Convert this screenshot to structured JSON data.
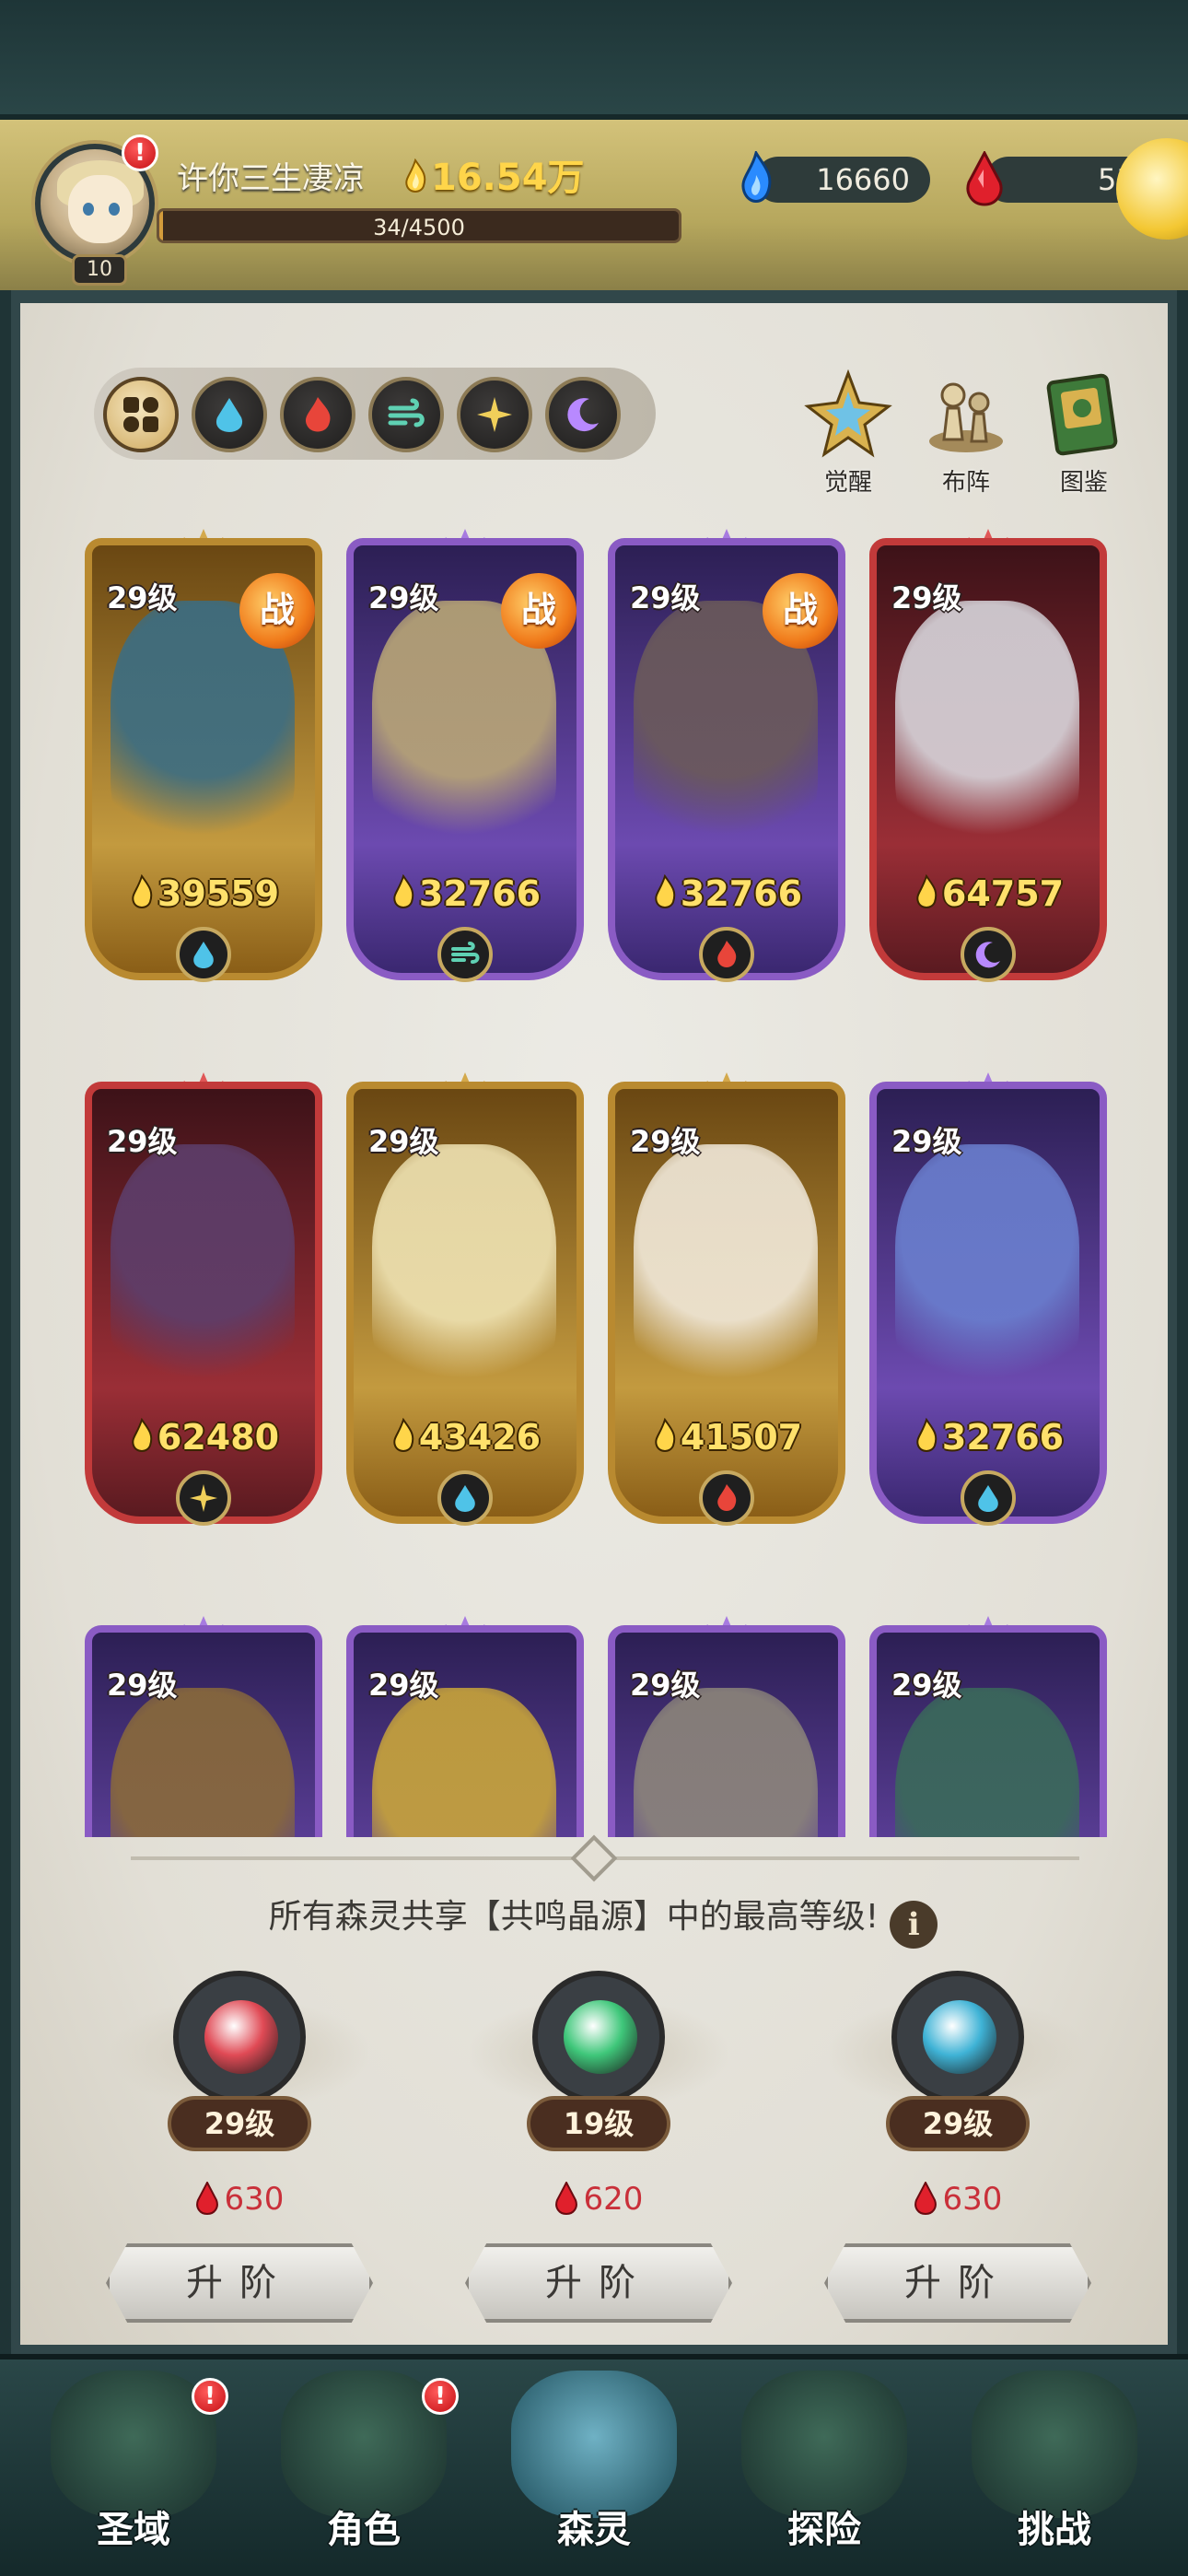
{
  "player": {
    "name": "许你三生凄凉",
    "level": "10",
    "gold": "16.54万",
    "exp_text": "34/4500",
    "exp_fraction": 0.0076
  },
  "resources": {
    "blue": {
      "value": "16660",
      "icon": "blue-flame-icon"
    },
    "red": {
      "value": "53",
      "icon": "red-drop-icon"
    }
  },
  "element_tabs": [
    {
      "icon": "all-icon",
      "active": true
    },
    {
      "icon": "water-icon",
      "active": false
    },
    {
      "icon": "fire-icon",
      "active": false
    },
    {
      "icon": "wind-icon",
      "active": false
    },
    {
      "icon": "light-icon",
      "active": false
    },
    {
      "icon": "dark-icon",
      "active": false
    }
  ],
  "top_buttons": [
    {
      "label": "觉醒",
      "icon": "awaken-icon"
    },
    {
      "label": "布阵",
      "icon": "formation-icon"
    },
    {
      "label": "图鉴",
      "icon": "codex-icon"
    }
  ],
  "cards": [
    {
      "level": "29级",
      "power": "39559",
      "rarity": "gold",
      "element": "water",
      "battle": "战",
      "art": "#3a6d84"
    },
    {
      "level": "29级",
      "power": "32766",
      "rarity": "purple",
      "element": "wind",
      "battle": "战",
      "art": "#b9a676"
    },
    {
      "level": "29级",
      "power": "32766",
      "rarity": "purple",
      "element": "fire",
      "battle": "战",
      "art": "#6b5a5a"
    },
    {
      "level": "29级",
      "power": "64757",
      "rarity": "red",
      "element": "dark",
      "battle": "",
      "art": "#d8d6dc"
    },
    {
      "level": "29级",
      "power": "62480",
      "rarity": "red",
      "element": "light",
      "battle": "",
      "art": "#5d3e6b"
    },
    {
      "level": "29级",
      "power": "43426",
      "rarity": "gold",
      "element": "water",
      "battle": "",
      "art": "#efe3b3"
    },
    {
      "level": "29级",
      "power": "41507",
      "rarity": "gold",
      "element": "fire",
      "battle": "",
      "art": "#f1e9da"
    },
    {
      "level": "29级",
      "power": "32766",
      "rarity": "purple",
      "element": "water",
      "battle": "",
      "art": "#6a7fcf"
    },
    {
      "level": "29级",
      "power": "",
      "rarity": "purple",
      "element": "",
      "battle": "",
      "art": "#8a6a3a"
    },
    {
      "level": "29级",
      "power": "",
      "rarity": "purple",
      "element": "",
      "battle": "",
      "art": "#c9a53a"
    },
    {
      "level": "29级",
      "power": "",
      "rarity": "purple",
      "element": "",
      "battle": "",
      "art": "#8c857a"
    },
    {
      "level": "29级",
      "power": "",
      "rarity": "purple",
      "element": "",
      "battle": "",
      "art": "#3a6a5a"
    }
  ],
  "resonance": {
    "text": "所有森灵共享【共鸣晶源】中的最高等级!",
    "info_glyph": "i",
    "crystals": [
      {
        "level": "29级",
        "cost": "630",
        "color": "#e04a55",
        "button": "升阶"
      },
      {
        "level": "19级",
        "cost": "620",
        "color": "#3fc77a",
        "button": "升阶"
      },
      {
        "level": "29级",
        "cost": "630",
        "color": "#3fb3d6",
        "button": "升阶"
      }
    ]
  },
  "nav": [
    {
      "label": "圣域",
      "icon": "sanctuary-icon",
      "alert": "!"
    },
    {
      "label": "角色",
      "icon": "character-icon",
      "alert": "!"
    },
    {
      "label": "森灵",
      "icon": "spirit-icon",
      "alert": ""
    },
    {
      "label": "探险",
      "icon": "explore-icon",
      "alert": ""
    },
    {
      "label": "挑战",
      "icon": "challenge-icon",
      "alert": ""
    }
  ],
  "colors": {
    "gold_text": "#ffd54a",
    "accent_orange": "#f07a1a",
    "cost_red": "#c9303a"
  }
}
